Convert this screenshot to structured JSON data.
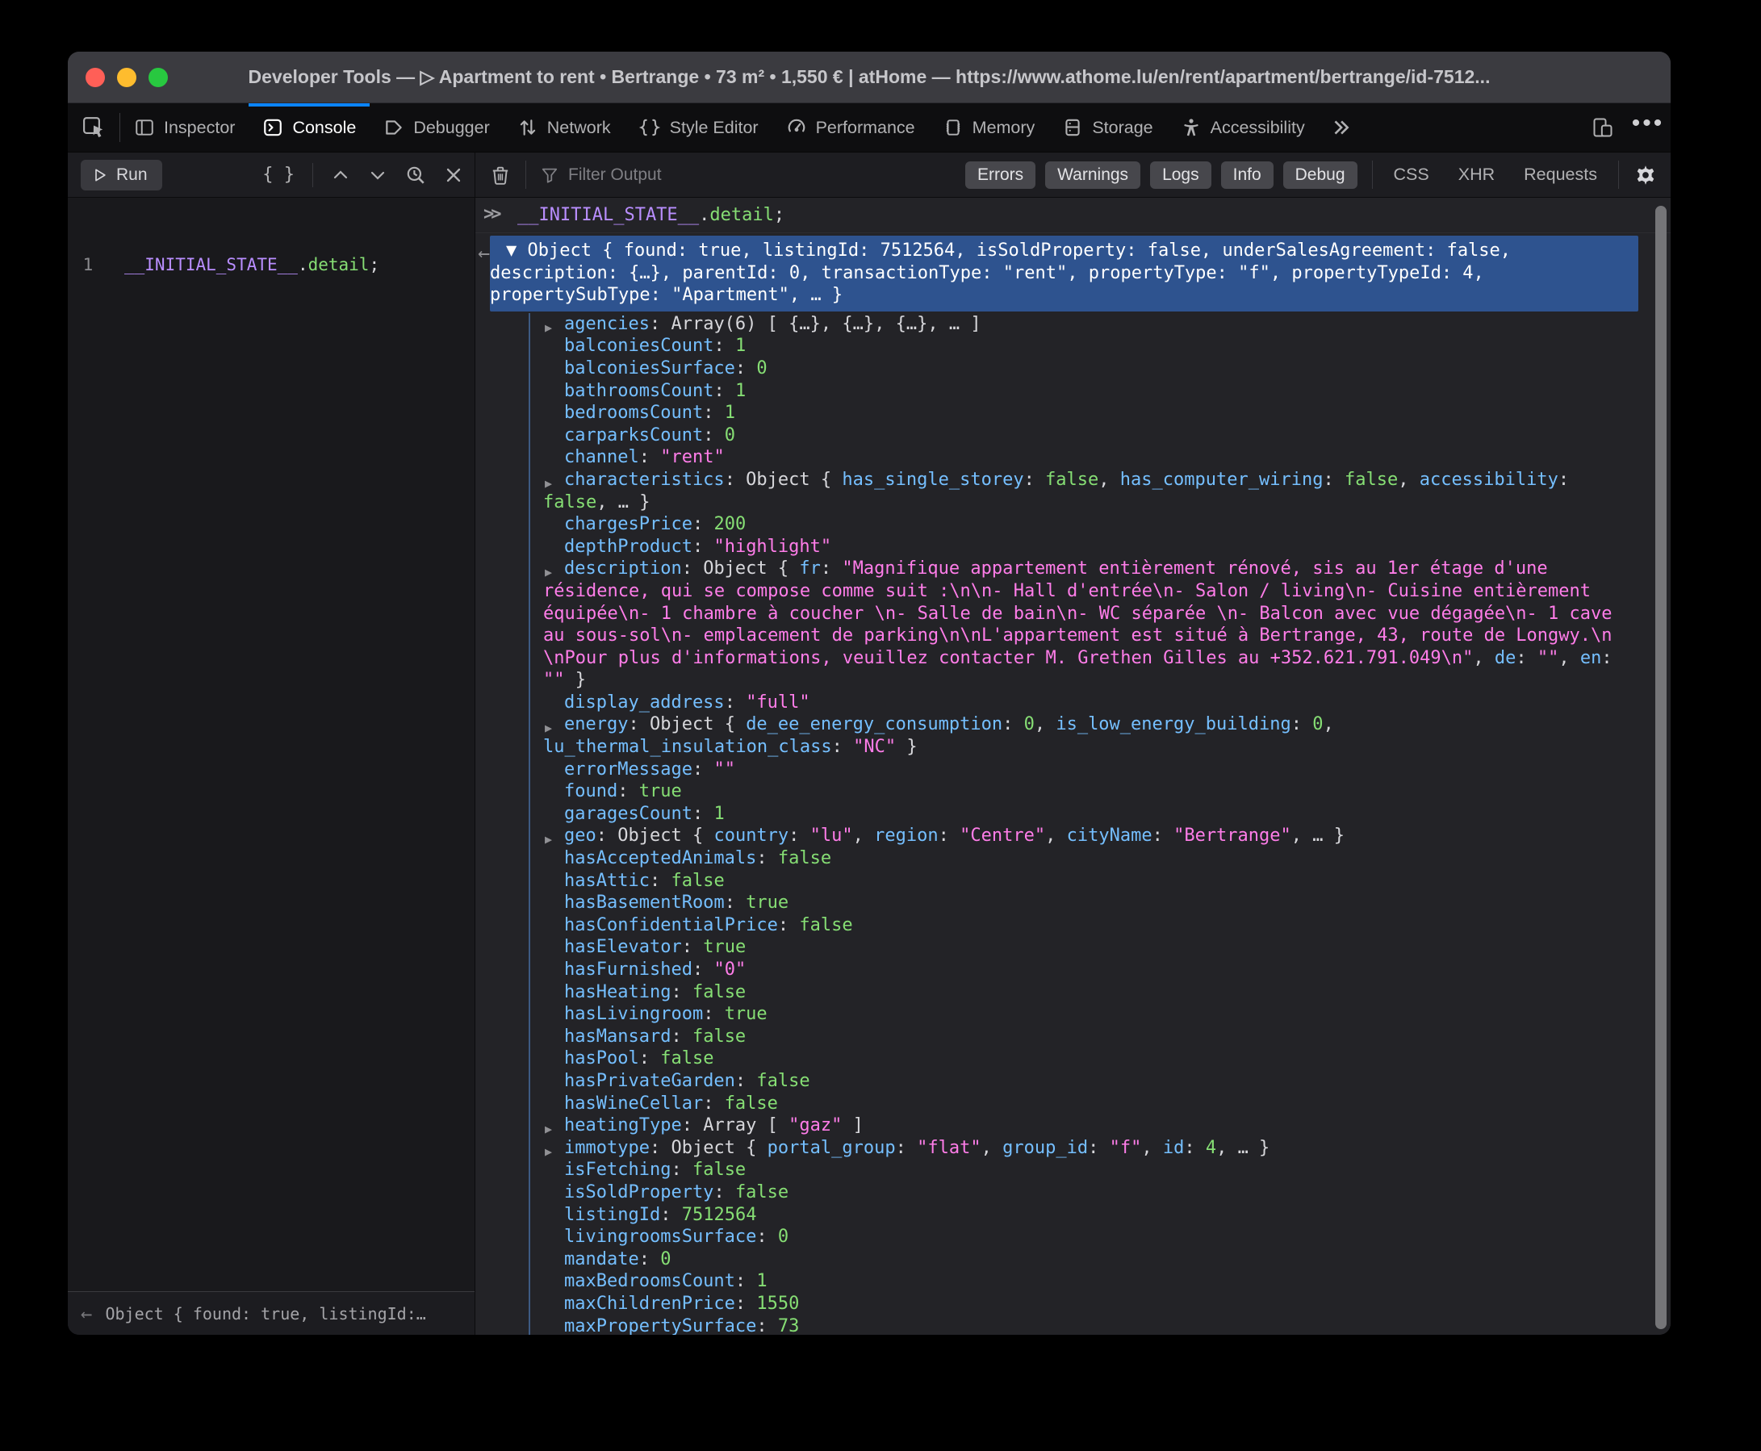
{
  "colors": {
    "accent_blue": "#0a84ff",
    "selection_blue": "#2e538f",
    "key_blue": "#75bfff",
    "value_green": "#86de74",
    "string_pink": "#ff7de9",
    "variable_purple": "#b98eff",
    "traffic_red": "#ff5f57",
    "traffic_yellow": "#febc2e",
    "traffic_green": "#28c840"
  },
  "window": {
    "title": "Developer Tools — ▷ Apartment to rent • Bertrange • 73 m² • 1,550 € | atHome — https://www.athome.lu/en/rent/apartment/bertrange/id-7512..."
  },
  "tabbar": {
    "tabs": [
      {
        "id": "inspector",
        "label": "Inspector",
        "icon": "inspector-icon",
        "active": false
      },
      {
        "id": "console",
        "label": "Console",
        "icon": "console-icon",
        "active": true
      },
      {
        "id": "debugger",
        "label": "Debugger",
        "icon": "debugger-icon",
        "active": false
      },
      {
        "id": "network",
        "label": "Network",
        "icon": "network-icon",
        "active": false
      },
      {
        "id": "style-editor",
        "label": "Style Editor",
        "icon": "style-editor-icon",
        "active": false
      },
      {
        "id": "performance",
        "label": "Performance",
        "icon": "performance-icon",
        "active": false
      },
      {
        "id": "memory",
        "label": "Memory",
        "icon": "memory-icon",
        "active": false
      },
      {
        "id": "storage",
        "label": "Storage",
        "icon": "storage-icon",
        "active": false
      },
      {
        "id": "accessibility",
        "label": "Accessibility",
        "icon": "accessibility-icon",
        "active": false
      }
    ]
  },
  "toolbar": {
    "run_label": "Run",
    "filter_placeholder": "Filter Output",
    "filter_pills": [
      "Errors",
      "Warnings",
      "Logs",
      "Info",
      "Debug"
    ],
    "net_filters": [
      "CSS",
      "XHR",
      "Requests"
    ]
  },
  "editor": {
    "line_number": "1",
    "code": [
      [
        "v",
        "__INITIAL_STATE__"
      ],
      [
        "p",
        "."
      ],
      [
        "n",
        "detail"
      ],
      [
        "p",
        ";"
      ]
    ]
  },
  "preview_bar": {
    "text": "Object { found: true, listingId:…"
  },
  "console": {
    "echo": [
      [
        "v",
        "__INITIAL_STATE__"
      ],
      [
        "p",
        "."
      ],
      [
        "n",
        "detail"
      ],
      [
        "p",
        ";"
      ]
    ],
    "selected": {
      "lines": [
        "▼ Object { found: true, listingId: 7512564, isSoldProperty: false, underSalesAgreement: false,",
        "description: {…}, parentId: 0, transactionType: \"rent\", propertyType: \"f\", propertyTypeId: 4,",
        "propertySubType: \"Apartment\", … }"
      ]
    },
    "rows": [
      {
        "a": true,
        "lines": [
          [
            [
              "k",
              "agencies"
            ],
            [
              "p",
              ": Array(6) [ {…}, {…}, {…}, … ]"
            ]
          ]
        ]
      },
      {
        "a": false,
        "lines": [
          [
            [
              "k",
              "balconiesCount"
            ],
            [
              "p",
              ": "
            ],
            [
              "n",
              "1"
            ]
          ]
        ]
      },
      {
        "a": false,
        "lines": [
          [
            [
              "k",
              "balconiesSurface"
            ],
            [
              "p",
              ": "
            ],
            [
              "n",
              "0"
            ]
          ]
        ]
      },
      {
        "a": false,
        "lines": [
          [
            [
              "k",
              "bathroomsCount"
            ],
            [
              "p",
              ": "
            ],
            [
              "n",
              "1"
            ]
          ]
        ]
      },
      {
        "a": false,
        "lines": [
          [
            [
              "k",
              "bedroomsCount"
            ],
            [
              "p",
              ": "
            ],
            [
              "n",
              "1"
            ]
          ]
        ]
      },
      {
        "a": false,
        "lines": [
          [
            [
              "k",
              "carparksCount"
            ],
            [
              "p",
              ": "
            ],
            [
              "n",
              "0"
            ]
          ]
        ]
      },
      {
        "a": false,
        "lines": [
          [
            [
              "k",
              "channel"
            ],
            [
              "p",
              ": "
            ],
            [
              "s",
              "\"rent\""
            ]
          ]
        ]
      },
      {
        "a": true,
        "lines": [
          [
            [
              "k",
              "characteristics"
            ],
            [
              "p",
              ": Object { "
            ],
            [
              "k",
              "has_single_storey"
            ],
            [
              "p",
              ": "
            ],
            [
              "n",
              "false"
            ],
            [
              "p",
              ", "
            ],
            [
              "k",
              "has_computer_wiring"
            ],
            [
              "p",
              ": "
            ],
            [
              "n",
              "false"
            ],
            [
              "p",
              ", "
            ],
            [
              "k",
              "accessibility"
            ],
            [
              "p",
              ":"
            ]
          ],
          [
            [
              "n",
              "false"
            ],
            [
              "p",
              ", … }"
            ]
          ]
        ]
      },
      {
        "a": false,
        "lines": [
          [
            [
              "k",
              "chargesPrice"
            ],
            [
              "p",
              ": "
            ],
            [
              "n",
              "200"
            ]
          ]
        ]
      },
      {
        "a": false,
        "lines": [
          [
            [
              "k",
              "depthProduct"
            ],
            [
              "p",
              ": "
            ],
            [
              "s",
              "\"highlight\""
            ]
          ]
        ]
      },
      {
        "a": true,
        "lines": [
          [
            [
              "k",
              "description"
            ],
            [
              "p",
              ": Object { "
            ],
            [
              "k",
              "fr"
            ],
            [
              "p",
              ": "
            ],
            [
              "s",
              "\"Magnifique appartement entièrement rénové, sis au 1er étage d'une"
            ]
          ],
          [
            [
              "s",
              "résidence, qui se compose comme suit :\\n\\n- Hall d'entrée\\n- Salon / living\\n- Cuisine entièrement"
            ]
          ],
          [
            [
              "s",
              "équipée\\n- 1 chambre à coucher \\n- Salle de bain\\n- WC séparée \\n- Balcon avec vue dégagée\\n- 1 cave"
            ]
          ],
          [
            [
              "s",
              "au sous-sol\\n- emplacement de parking\\n\\nL'appartement est situé à Bertrange, 43, route de Longwy.\\n"
            ]
          ],
          [
            [
              "s",
              "\\nPour plus d'informations, veuillez contacter M. Grethen Gilles au +352.621.791.049\\n\""
            ],
            [
              "p",
              ", "
            ],
            [
              "k",
              "de"
            ],
            [
              "p",
              ": "
            ],
            [
              "s",
              "\"\""
            ],
            [
              "p",
              ", "
            ],
            [
              "k",
              "en"
            ],
            [
              "p",
              ":"
            ]
          ],
          [
            [
              "s",
              "\"\""
            ],
            [
              "p",
              " }"
            ]
          ]
        ]
      },
      {
        "a": false,
        "lines": [
          [
            [
              "k",
              "display_address"
            ],
            [
              "p",
              ": "
            ],
            [
              "s",
              "\"full\""
            ]
          ]
        ]
      },
      {
        "a": true,
        "lines": [
          [
            [
              "k",
              "energy"
            ],
            [
              "p",
              ": Object { "
            ],
            [
              "k",
              "de_ee_energy_consumption"
            ],
            [
              "p",
              ": "
            ],
            [
              "n",
              "0"
            ],
            [
              "p",
              ", "
            ],
            [
              "k",
              "is_low_energy_building"
            ],
            [
              "p",
              ": "
            ],
            [
              "n",
              "0"
            ],
            [
              "p",
              ","
            ]
          ],
          [
            [
              "k",
              "lu_thermal_insulation_class"
            ],
            [
              "p",
              ": "
            ],
            [
              "s",
              "\"NC\""
            ],
            [
              "p",
              " }"
            ]
          ]
        ]
      },
      {
        "a": false,
        "lines": [
          [
            [
              "k",
              "errorMessage"
            ],
            [
              "p",
              ": "
            ],
            [
              "s",
              "\"\""
            ]
          ]
        ]
      },
      {
        "a": false,
        "lines": [
          [
            [
              "k",
              "found"
            ],
            [
              "p",
              ": "
            ],
            [
              "n",
              "true"
            ]
          ]
        ]
      },
      {
        "a": false,
        "lines": [
          [
            [
              "k",
              "garagesCount"
            ],
            [
              "p",
              ": "
            ],
            [
              "n",
              "1"
            ]
          ]
        ]
      },
      {
        "a": true,
        "lines": [
          [
            [
              "k",
              "geo"
            ],
            [
              "p",
              ": Object { "
            ],
            [
              "k",
              "country"
            ],
            [
              "p",
              ": "
            ],
            [
              "s",
              "\"lu\""
            ],
            [
              "p",
              ", "
            ],
            [
              "k",
              "region"
            ],
            [
              "p",
              ": "
            ],
            [
              "s",
              "\"Centre\""
            ],
            [
              "p",
              ", "
            ],
            [
              "k",
              "cityName"
            ],
            [
              "p",
              ": "
            ],
            [
              "s",
              "\"Bertrange\""
            ],
            [
              "p",
              ", … }"
            ]
          ]
        ]
      },
      {
        "a": false,
        "lines": [
          [
            [
              "k",
              "hasAcceptedAnimals"
            ],
            [
              "p",
              ": "
            ],
            [
              "n",
              "false"
            ]
          ]
        ]
      },
      {
        "a": false,
        "lines": [
          [
            [
              "k",
              "hasAttic"
            ],
            [
              "p",
              ": "
            ],
            [
              "n",
              "false"
            ]
          ]
        ]
      },
      {
        "a": false,
        "lines": [
          [
            [
              "k",
              "hasBasementRoom"
            ],
            [
              "p",
              ": "
            ],
            [
              "n",
              "true"
            ]
          ]
        ]
      },
      {
        "a": false,
        "lines": [
          [
            [
              "k",
              "hasConfidentialPrice"
            ],
            [
              "p",
              ": "
            ],
            [
              "n",
              "false"
            ]
          ]
        ]
      },
      {
        "a": false,
        "lines": [
          [
            [
              "k",
              "hasElevator"
            ],
            [
              "p",
              ": "
            ],
            [
              "n",
              "true"
            ]
          ]
        ]
      },
      {
        "a": false,
        "lines": [
          [
            [
              "k",
              "hasFurnished"
            ],
            [
              "p",
              ": "
            ],
            [
              "s",
              "\"0\""
            ]
          ]
        ]
      },
      {
        "a": false,
        "lines": [
          [
            [
              "k",
              "hasHeating"
            ],
            [
              "p",
              ": "
            ],
            [
              "n",
              "false"
            ]
          ]
        ]
      },
      {
        "a": false,
        "lines": [
          [
            [
              "k",
              "hasLivingroom"
            ],
            [
              "p",
              ": "
            ],
            [
              "n",
              "true"
            ]
          ]
        ]
      },
      {
        "a": false,
        "lines": [
          [
            [
              "k",
              "hasMansard"
            ],
            [
              "p",
              ": "
            ],
            [
              "n",
              "false"
            ]
          ]
        ]
      },
      {
        "a": false,
        "lines": [
          [
            [
              "k",
              "hasPool"
            ],
            [
              "p",
              ": "
            ],
            [
              "n",
              "false"
            ]
          ]
        ]
      },
      {
        "a": false,
        "lines": [
          [
            [
              "k",
              "hasPrivateGarden"
            ],
            [
              "p",
              ": "
            ],
            [
              "n",
              "false"
            ]
          ]
        ]
      },
      {
        "a": false,
        "lines": [
          [
            [
              "k",
              "hasWineCellar"
            ],
            [
              "p",
              ": "
            ],
            [
              "n",
              "false"
            ]
          ]
        ]
      },
      {
        "a": true,
        "lines": [
          [
            [
              "k",
              "heatingType"
            ],
            [
              "p",
              ": Array [ "
            ],
            [
              "s",
              "\"gaz\""
            ],
            [
              "p",
              " ]"
            ]
          ]
        ]
      },
      {
        "a": true,
        "lines": [
          [
            [
              "k",
              "immotype"
            ],
            [
              "p",
              ": Object { "
            ],
            [
              "k",
              "portal_group"
            ],
            [
              "p",
              ": "
            ],
            [
              "s",
              "\"flat\""
            ],
            [
              "p",
              ", "
            ],
            [
              "k",
              "group_id"
            ],
            [
              "p",
              ": "
            ],
            [
              "s",
              "\"f\""
            ],
            [
              "p",
              ", "
            ],
            [
              "k",
              "id"
            ],
            [
              "p",
              ": "
            ],
            [
              "n",
              "4"
            ],
            [
              "p",
              ", … }"
            ]
          ]
        ]
      },
      {
        "a": false,
        "lines": [
          [
            [
              "k",
              "isFetching"
            ],
            [
              "p",
              ": "
            ],
            [
              "n",
              "false"
            ]
          ]
        ]
      },
      {
        "a": false,
        "lines": [
          [
            [
              "k",
              "isSoldProperty"
            ],
            [
              "p",
              ": "
            ],
            [
              "n",
              "false"
            ]
          ]
        ]
      },
      {
        "a": false,
        "lines": [
          [
            [
              "k",
              "listingId"
            ],
            [
              "p",
              ": "
            ],
            [
              "n",
              "7512564"
            ]
          ]
        ]
      },
      {
        "a": false,
        "lines": [
          [
            [
              "k",
              "livingroomsSurface"
            ],
            [
              "p",
              ": "
            ],
            [
              "n",
              "0"
            ]
          ]
        ]
      },
      {
        "a": false,
        "lines": [
          [
            [
              "k",
              "mandate"
            ],
            [
              "p",
              ": "
            ],
            [
              "n",
              "0"
            ]
          ]
        ]
      },
      {
        "a": false,
        "lines": [
          [
            [
              "k",
              "maxBedroomsCount"
            ],
            [
              "p",
              ": "
            ],
            [
              "n",
              "1"
            ]
          ]
        ]
      },
      {
        "a": false,
        "lines": [
          [
            [
              "k",
              "maxChildrenPrice"
            ],
            [
              "p",
              ": "
            ],
            [
              "n",
              "1550"
            ]
          ]
        ]
      },
      {
        "a": false,
        "lines": [
          [
            [
              "k",
              "maxPropertySurface"
            ],
            [
              "p",
              ": "
            ],
            [
              "n",
              "73"
            ]
          ]
        ]
      }
    ]
  }
}
